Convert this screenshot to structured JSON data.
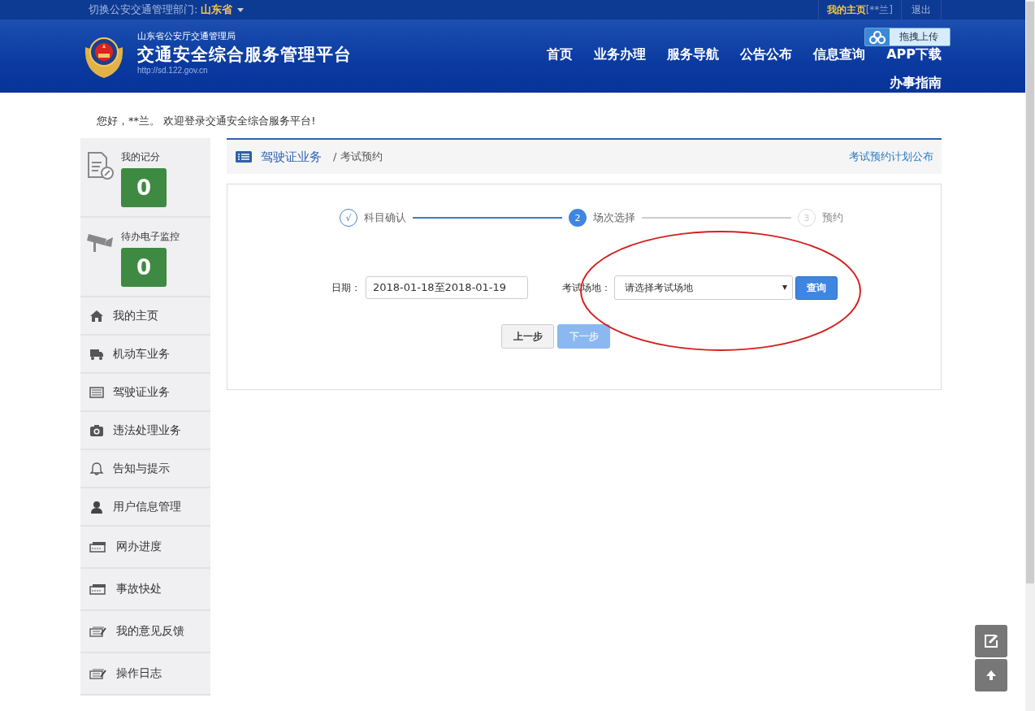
{
  "top_bar": {
    "switch_label": "切换公安交通管理部门:",
    "province": "山东省",
    "home_link": "我的主页",
    "user": "[**兰]",
    "logout": "退出"
  },
  "header": {
    "agency": "山东省公安厅交通管理局",
    "title": "交通安全综合服务管理平台",
    "url": "http://sd.122.gov.cn",
    "upload_button": "拖拽上传",
    "nav": [
      "首页",
      "业务办理",
      "服务导航",
      "公告公布",
      "信息查询",
      "APP下载",
      "办事指南"
    ]
  },
  "greeting": "您好，**兰。 欢迎登录交通安全综合服务平台!",
  "sidebar": {
    "stats": [
      {
        "label": "我的记分",
        "value": "0"
      },
      {
        "label": "待办电子监控",
        "value": "0"
      }
    ],
    "items": [
      "我的主页",
      "机动车业务",
      "驾驶证业务",
      "违法处理业务",
      "告知与提示",
      "用户信息管理",
      "网办进度",
      "事故快处",
      "我的意见反馈",
      "操作日志"
    ]
  },
  "breadcrumb": {
    "section": "驾驶证业务",
    "page": "/ 考试预约",
    "link": "考试预约计划公布"
  },
  "steps": [
    {
      "marker": "√",
      "label": "科目确认",
      "kind": "done"
    },
    {
      "marker": "2",
      "label": "场次选择",
      "kind": "current"
    },
    {
      "marker": "3",
      "label": "预约",
      "kind": "pending"
    }
  ],
  "form": {
    "date_label": "日期：",
    "date_value": "2018-01-18至2018-01-19",
    "venue_label": "考试场地：",
    "venue_placeholder": "请选择考试场地",
    "query_button": "查询"
  },
  "buttons": [
    {
      "label": "上一步",
      "disabled": false
    },
    {
      "label": "下一步",
      "disabled": true
    }
  ]
}
